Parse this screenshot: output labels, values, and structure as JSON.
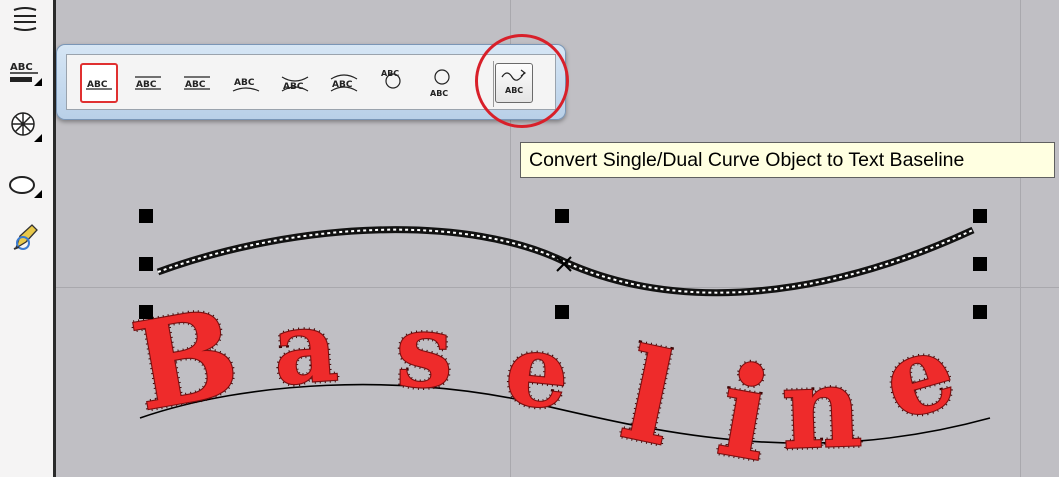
{
  "toolbar": {
    "left_tools": [
      "menu-lines-icon",
      "abc-baseline-icon",
      "radial-burst-icon",
      "ellipse-icon",
      "pen-edit-icon"
    ],
    "left_tools_label": "ABC"
  },
  "baseline_popup": {
    "buttons": [
      {
        "name": "straight-baseline-button",
        "glyph": "ABC",
        "selected": true
      },
      {
        "name": "overline-baseline-button",
        "glyph": "ABC"
      },
      {
        "name": "dual-line-baseline-button",
        "glyph": "ABC"
      },
      {
        "name": "arc-top-baseline-button",
        "glyph": "ABC"
      },
      {
        "name": "arc-bottom-baseline-button",
        "glyph": "ABC"
      },
      {
        "name": "arch-baseline-button",
        "glyph": "ABC"
      },
      {
        "name": "circle-top-baseline-button",
        "glyph": "ABC"
      },
      {
        "name": "circle-bottom-baseline-button",
        "glyph": "ABC"
      },
      {
        "name": "convert-curve-to-baseline-button",
        "glyph": "ABC",
        "highlighted": true
      }
    ]
  },
  "tooltip": {
    "text": "Convert Single/Dual Curve Object to Text Baseline"
  },
  "canvas": {
    "text_object": "Baseline",
    "letters": [
      "B",
      "a",
      "s",
      "e",
      "l",
      "i",
      "n",
      "e"
    ],
    "text_color": "#ee2b2b",
    "highlight_color": "#d8202a"
  }
}
